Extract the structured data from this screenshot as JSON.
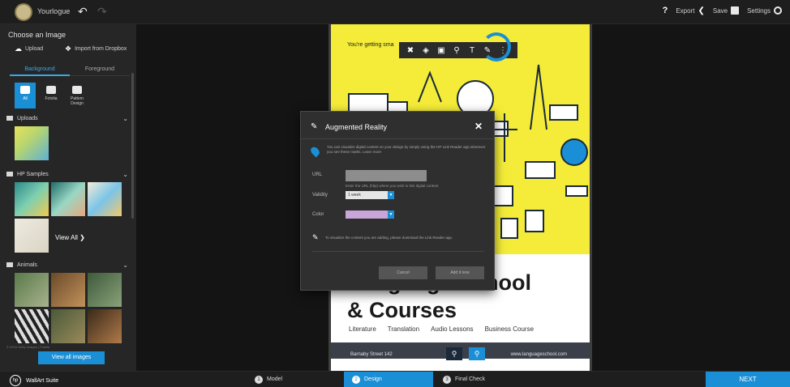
{
  "topbar": {
    "logo_name": "Yourlogue",
    "help": "?",
    "export_label": "Export",
    "save_label": "Save",
    "settings_label": "Settings"
  },
  "left_panel": {
    "title": "Choose an Image",
    "upload_label": "Upload",
    "dropbox_label": "Import from Dropbox",
    "tabs": [
      {
        "label": "Background",
        "active": true
      },
      {
        "label": "Foreground",
        "active": false
      }
    ],
    "types": [
      {
        "label": "All",
        "active": true
      },
      {
        "label": "Fotolia",
        "active": false
      },
      {
        "label": "Pattern Design",
        "active": false
      }
    ],
    "sections": [
      {
        "label": "Uploads"
      },
      {
        "label": "HP Samples"
      },
      {
        "label": "Animals"
      }
    ],
    "view_all_inline": "View All ❯",
    "view_all_button": "View all images",
    "credit": "© 2016 Getty Images | Fotolia"
  },
  "design": {
    "tagline": "You're getting sma",
    "title_line1": "Language School",
    "title_line2": "& Courses",
    "subjects": [
      "Literature",
      "Translation",
      "Audio Lessons",
      "Business Course"
    ],
    "address": "Barnaby Street 142",
    "url": "www.languageschool.com",
    "zoom_out_icon": "zoom-out-icon",
    "zoom_in_icon": "zoom-in-icon"
  },
  "modal": {
    "title": "Augmented Reality",
    "description": "You can visualize digital content on your design by simply using the HP Link Reader app wherever you see these marks. Learn more",
    "url_label": "URL",
    "url_hint": "Enter the URL (http) where you wish to link digital content",
    "validity_label": "Validity",
    "validity_value": "1 week",
    "color_label": "Color",
    "note": "To visualize the content you are adding, please download the Link Reader app.",
    "cancel_label": "Cancel",
    "add_label": "Add it now"
  },
  "bottombar": {
    "brand": "WallArt Suite",
    "steps": [
      {
        "num": "1",
        "label": "Model",
        "active": false
      },
      {
        "num": "2",
        "label": "Design",
        "active": true
      },
      {
        "num": "3",
        "label": "Final Check",
        "active": false
      }
    ],
    "next_label": "NEXT"
  },
  "colors": {
    "accent": "#1a8fd6",
    "design_yellow": "#f4ec38",
    "panel": "#262626"
  }
}
